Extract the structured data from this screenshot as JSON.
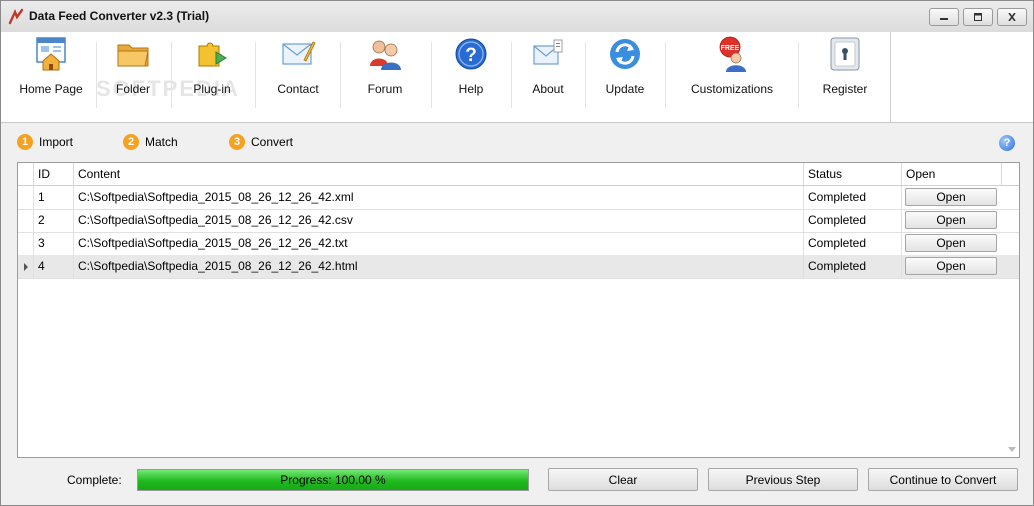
{
  "window": {
    "title": "Data Feed Converter v2.3 (Trial)",
    "watermark": "SOFTPEDIA"
  },
  "toolbar": {
    "items": [
      {
        "label": "Home Page",
        "icon": "home-icon"
      },
      {
        "label": "Folder",
        "icon": "folder-icon"
      },
      {
        "label": "Plug-in",
        "icon": "plugin-icon"
      },
      {
        "label": "Contact",
        "icon": "contact-icon"
      },
      {
        "label": "Forum",
        "icon": "forum-icon"
      },
      {
        "label": "Help",
        "icon": "help-icon"
      },
      {
        "label": "About",
        "icon": "about-icon"
      },
      {
        "label": "Update",
        "icon": "update-icon"
      },
      {
        "label": "Customizations",
        "icon": "customizations-icon",
        "badge": "FREE"
      },
      {
        "label": "Register",
        "icon": "register-icon"
      }
    ]
  },
  "steps": [
    {
      "num": "1",
      "label": "Import"
    },
    {
      "num": "2",
      "label": "Match"
    },
    {
      "num": "3",
      "label": "Convert"
    }
  ],
  "grid": {
    "columns": [
      "ID",
      "Content",
      "Status",
      "Open"
    ],
    "rows": [
      {
        "id": "1",
        "content": "C:\\Softpedia\\Softpedia_2015_08_26_12_26_42.xml",
        "status": "Completed",
        "open": "Open"
      },
      {
        "id": "2",
        "content": "C:\\Softpedia\\Softpedia_2015_08_26_12_26_42.csv",
        "status": "Completed",
        "open": "Open"
      },
      {
        "id": "3",
        "content": "C:\\Softpedia\\Softpedia_2015_08_26_12_26_42.txt",
        "status": "Completed",
        "open": "Open"
      },
      {
        "id": "4",
        "content": "C:\\Softpedia\\Softpedia_2015_08_26_12_26_42.html",
        "status": "Completed",
        "open": "Open"
      }
    ]
  },
  "bottom": {
    "complete_label": "Complete:",
    "progress_text": "Progress: 100.00 %",
    "progress_value": 100,
    "clear": "Clear",
    "previous": "Previous Step",
    "continue": "Continue to Convert"
  },
  "colors": {
    "accent_orange": "#f4a21f",
    "progress_green": "#1fba1f",
    "help_blue": "#2d6fd6"
  }
}
